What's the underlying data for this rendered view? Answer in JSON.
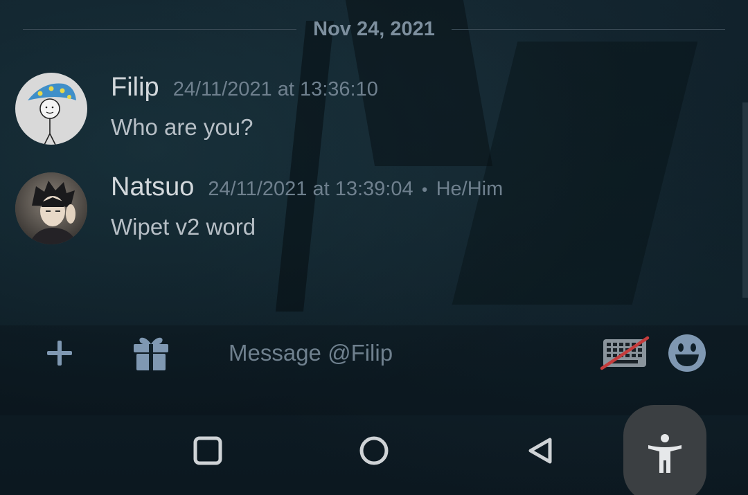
{
  "date_divider": "Nov 24, 2021",
  "messages": [
    {
      "author": "Filip",
      "timestamp": "24/11/2021 at 13:36:10",
      "text": "Who are you?"
    },
    {
      "author": "Natsuo",
      "timestamp": "24/11/2021 at 13:39:04",
      "separator": "•",
      "pronouns": "He/Him",
      "text": "Wipet v2 word"
    }
  ],
  "composer": {
    "placeholder": "Message @Filip",
    "icons": {
      "add": "plus-icon",
      "gift": "gift-icon",
      "keyboard": "keyboard-off-icon",
      "emoji": "emoji-icon"
    }
  },
  "nav_bar": {
    "icons": [
      "recents-square-icon",
      "home-circle-icon",
      "back-triangle-icon",
      "accessibility-icon"
    ]
  },
  "colors": {
    "background": "#0f1f28",
    "author_text": "#d3d8dc",
    "meta_text": "#6f808e",
    "message_text": "#b7bfc6",
    "icon_blue": "#7f98b2",
    "strike_red": "#c53c3c"
  }
}
